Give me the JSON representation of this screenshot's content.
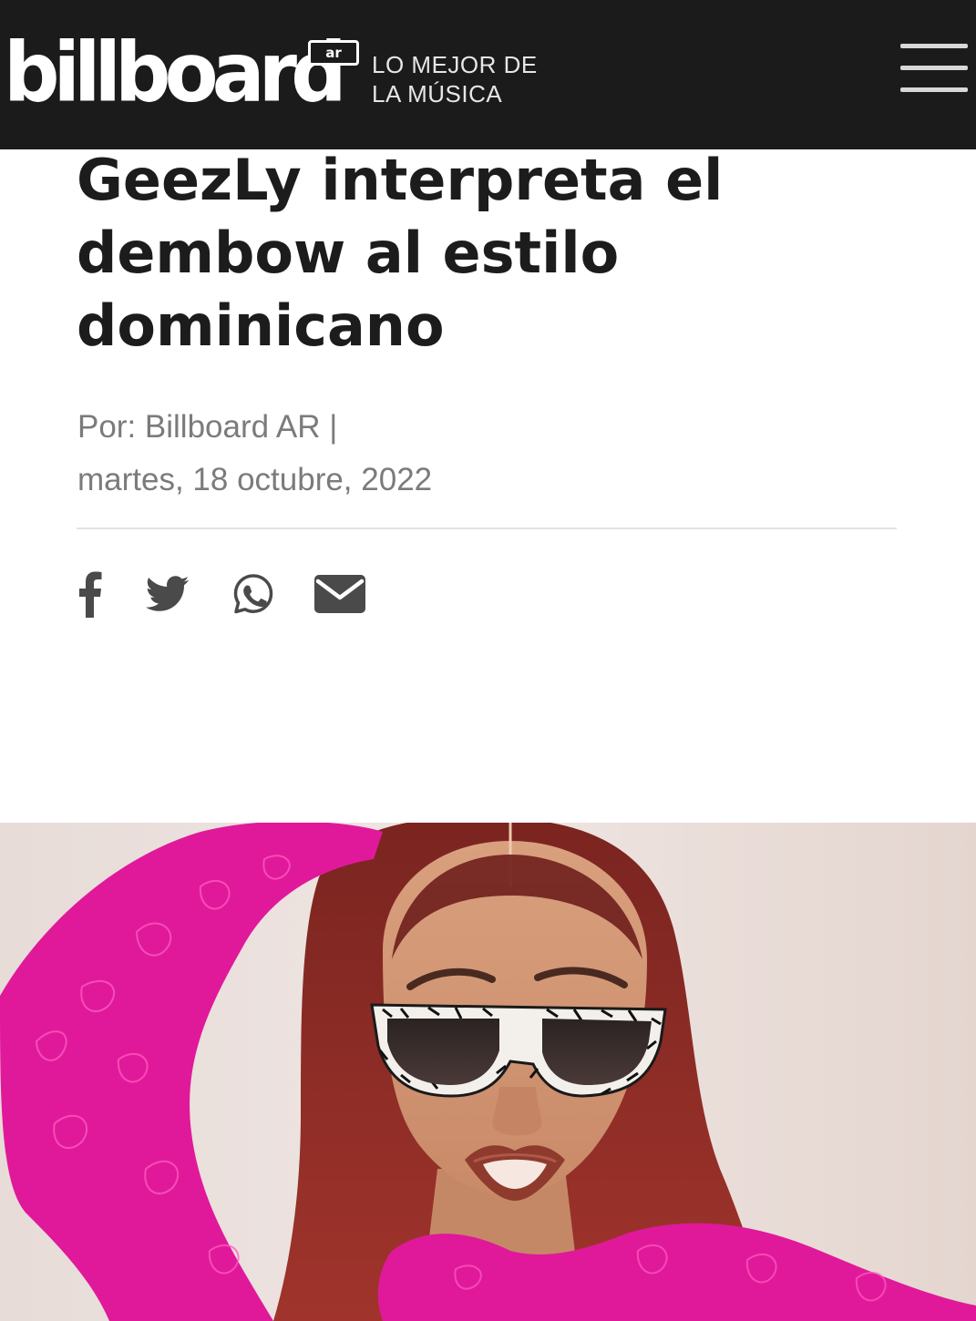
{
  "header": {
    "logo_text": "billboard",
    "logo_badge": "ar",
    "tagline_line1": "LO MEJOR DE",
    "tagline_line2": "LA MÚSICA",
    "menu_icon": "hamburger-menu-icon"
  },
  "article": {
    "headline_line1": "GeezLy interpreta el",
    "headline_line2": "dembow al estilo",
    "headline_line3": "dominicano",
    "author_line": "Por: Billboard AR |",
    "date_line": "martes, 18 octubre, 2022"
  },
  "share": {
    "icons": [
      "facebook-icon",
      "twitter-icon",
      "whatsapp-icon",
      "email-icon"
    ]
  },
  "colors": {
    "topbar": "#1b1b1b",
    "headline": "#1c1c1c",
    "meta": "#7b7b7b",
    "accent_pink": "#e0199a"
  }
}
